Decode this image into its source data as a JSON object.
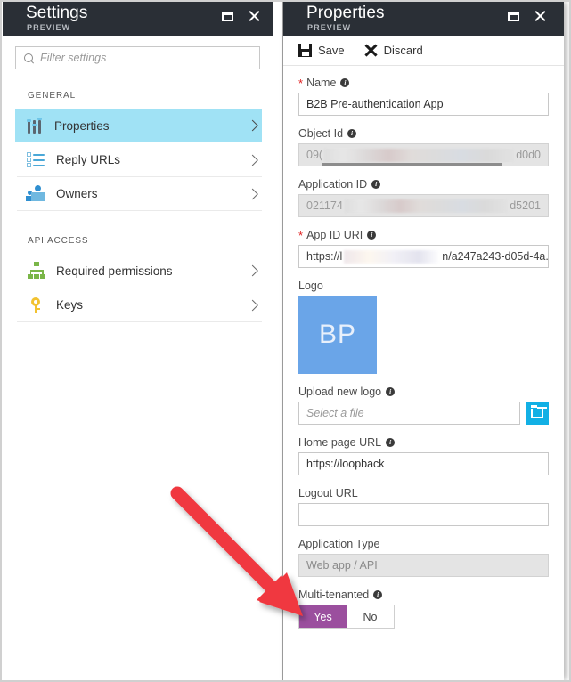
{
  "settings_blade": {
    "title": "Settings",
    "subtitle": "PREVIEW",
    "chrome": {
      "maximize": "maximize-icon",
      "close": "close-icon"
    },
    "filter": {
      "placeholder": "Filter settings",
      "icon": "search-icon"
    },
    "groups": [
      {
        "heading": "GENERAL",
        "items": [
          {
            "label": "Properties",
            "icon": "sliders-icon",
            "selected": true
          },
          {
            "label": "Reply URLs",
            "icon": "checklist-icon",
            "selected": false
          },
          {
            "label": "Owners",
            "icon": "people-icon",
            "selected": false
          }
        ]
      },
      {
        "heading": "API ACCESS",
        "items": [
          {
            "label": "Required permissions",
            "icon": "hierarchy-icon",
            "selected": false
          },
          {
            "label": "Keys",
            "icon": "key-icon",
            "selected": false
          }
        ]
      }
    ]
  },
  "properties_blade": {
    "title": "Properties",
    "subtitle": "PREVIEW",
    "chrome": {
      "maximize": "maximize-icon",
      "close": "close-icon"
    },
    "commands": [
      {
        "label": "Save",
        "icon": "save-icon"
      },
      {
        "label": "Discard",
        "icon": "discard-icon"
      }
    ],
    "fields": {
      "name": {
        "label": "Name",
        "required": true,
        "value": "B2B Pre-authentication App"
      },
      "object_id": {
        "label": "Object Id",
        "required": false,
        "readonly": true,
        "prefix": "09(",
        "suffix": "d0d0",
        "redacted": true
      },
      "application_id": {
        "label": "Application ID",
        "required": false,
        "readonly": true,
        "prefix": "021174",
        "suffix": "d5201",
        "redacted": true
      },
      "app_id_uri": {
        "label": "App ID URI",
        "required": true,
        "prefix": "https://l",
        "suffix": "n/a247a243-d05d-4a...",
        "redacted": true
      },
      "logo": {
        "label": "Logo",
        "initials": "BP",
        "color": "#6aa5e8"
      },
      "upload_new_logo": {
        "label": "Upload new logo",
        "placeholder": "Select a file",
        "browse_icon": "folder-icon"
      },
      "home_page_url": {
        "label": "Home page URL",
        "value": "https://loopback"
      },
      "logout_url": {
        "label": "Logout URL",
        "value": ""
      },
      "application_type": {
        "label": "Application Type",
        "readonly": true,
        "value": "Web app / API"
      },
      "multi_tenanted": {
        "label": "Multi-tenanted",
        "options": [
          "Yes",
          "No"
        ],
        "selected": "Yes",
        "accent": "#9b4f9e"
      }
    }
  },
  "annotation": {
    "type": "arrow",
    "color": "#f0393f",
    "points_at": "multi-tenanted-toggle"
  }
}
